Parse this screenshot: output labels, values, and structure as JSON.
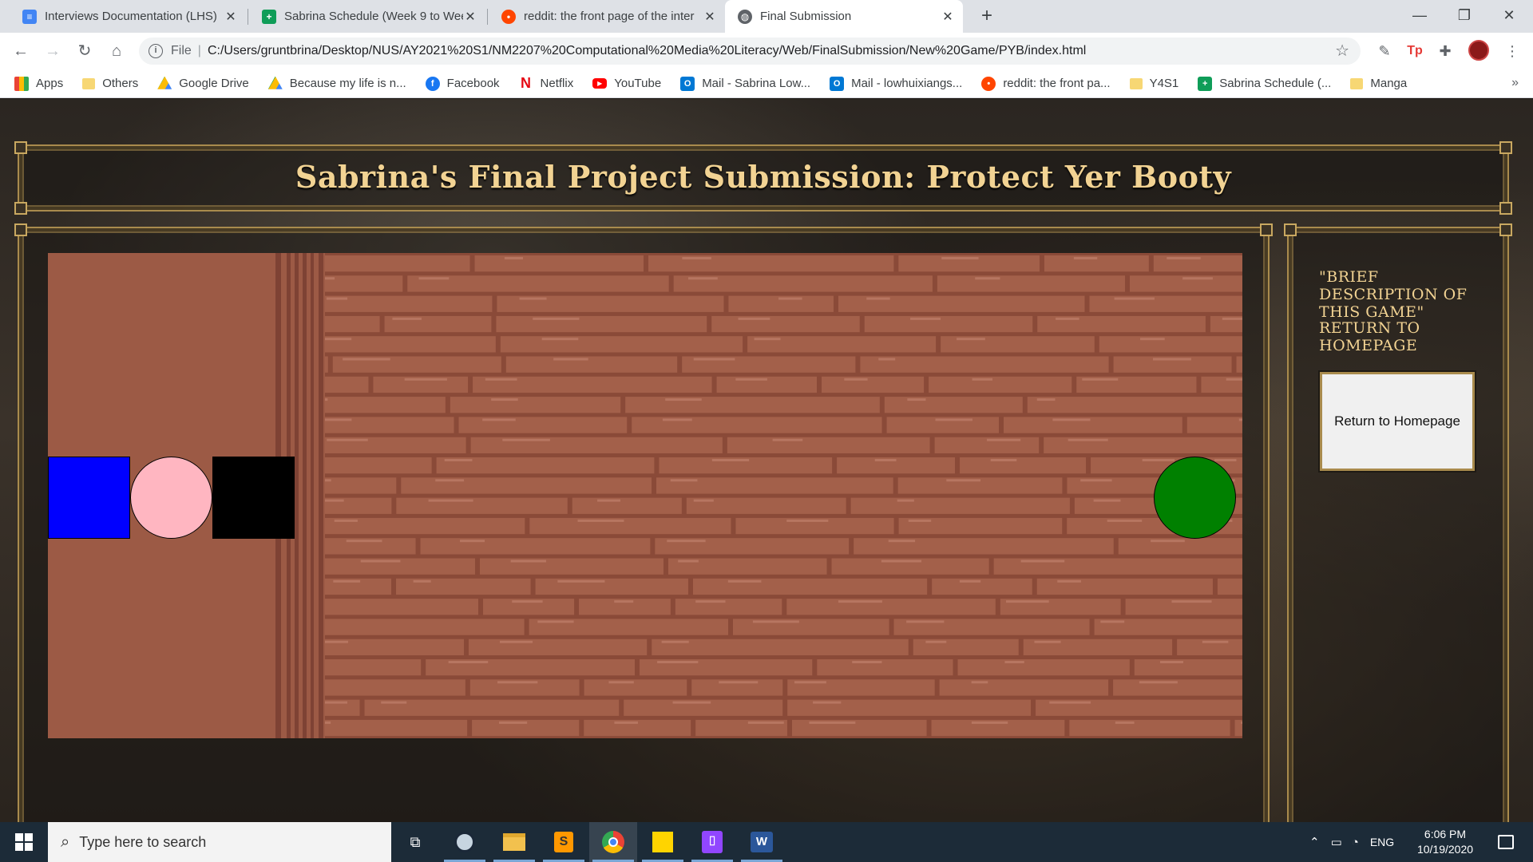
{
  "browser": {
    "tabs": [
      {
        "title": "Interviews Documentation (LHS)",
        "icon": "docs-icon",
        "color": "#4285f4",
        "active": false
      },
      {
        "title": "Sabrina Schedule (Week 9 to Wee",
        "icon": "sheets-icon",
        "color": "#0f9d58",
        "active": false
      },
      {
        "title": "reddit: the front page of the inter",
        "icon": "reddit-icon",
        "color": "#ff4500",
        "active": false
      },
      {
        "title": "Final Submission",
        "icon": "globe-icon",
        "color": "#5f6368",
        "active": true
      }
    ],
    "address": {
      "scheme_label": "File",
      "url": "C:/Users/gruntbrina/Desktop/NUS/AY2021%20S1/NM2207%20Computational%20Media%20Literacy/Web/FinalSubmission/New%20Game/PYB/index.html"
    },
    "bookmarks": [
      {
        "label": "Apps",
        "icon": "apps-grid-icon"
      },
      {
        "label": "Others",
        "icon": "folder-icon"
      },
      {
        "label": "Google Drive",
        "icon": "google-drive-icon"
      },
      {
        "label": "Because my life is n...",
        "icon": "google-drive-icon"
      },
      {
        "label": "Facebook",
        "icon": "facebook-icon"
      },
      {
        "label": "Netflix",
        "icon": "netflix-icon"
      },
      {
        "label": "YouTube",
        "icon": "youtube-icon"
      },
      {
        "label": "Mail - Sabrina Low...",
        "icon": "outlook-icon"
      },
      {
        "label": "Mail - lowhuixiangs...",
        "icon": "outlook-icon"
      },
      {
        "label": "reddit: the front pa...",
        "icon": "reddit-icon"
      },
      {
        "label": "Y4S1",
        "icon": "folder-icon"
      },
      {
        "label": "Sabrina Schedule (...",
        "icon": "sheets-icon"
      },
      {
        "label": "Manga",
        "icon": "folder-icon"
      }
    ],
    "bookmarks_more": "»"
  },
  "page": {
    "title": "Sabrina's Final Project Submission: Protect Yer Booty",
    "sidebar": {
      "description_link": "\"Brief Description of this game\"",
      "return_link": "Return to Homepage",
      "return_button": "Return to Homepage"
    },
    "game": {
      "background_color": "#9c5a45",
      "plank_color": "#a3604a",
      "pieces": [
        {
          "name": "blue-square",
          "shape": "square",
          "color": "#0000ff"
        },
        {
          "name": "pink-circle",
          "shape": "circle",
          "color": "#ffb6c1"
        },
        {
          "name": "black-square",
          "shape": "square",
          "color": "#000000"
        },
        {
          "name": "green-circle",
          "shape": "circle",
          "color": "#008000"
        }
      ]
    },
    "accent_color": "#f2d393",
    "frame_color": "#a98b4d"
  },
  "taskbar": {
    "search_placeholder": "Type here to search",
    "apps": [
      "task-view-icon",
      "steam-icon",
      "file-explorer-icon",
      "sublime-text-icon",
      "chrome-icon",
      "sticky-notes-icon",
      "twitch-icon",
      "word-icon"
    ],
    "language": "ENG",
    "time": "6:06 PM",
    "date": "10/19/2020"
  }
}
